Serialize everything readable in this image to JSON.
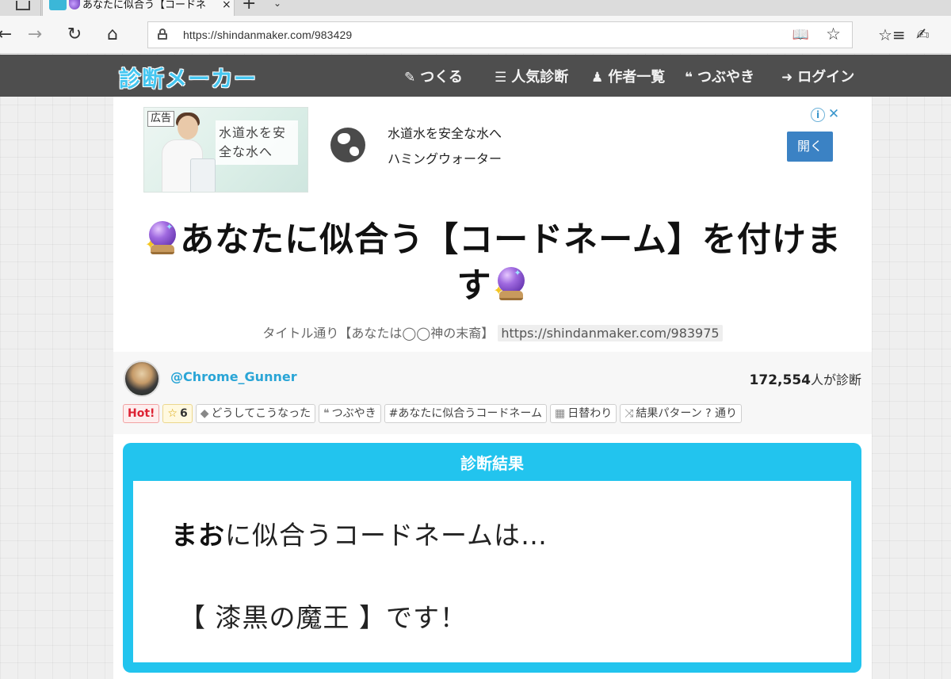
{
  "browser": {
    "tab_title": "あなたに似合う【コードネ",
    "tab_close": "×",
    "new_tab": "+",
    "tab_list": "⌄",
    "url": "https://shindanmaker.com/983429",
    "icons": [
      "back-icon",
      "forward-icon",
      "refresh-icon",
      "home-icon",
      "lock-icon",
      "reading-view-icon",
      "favorite-star-icon",
      "favorites-list-icon",
      "pen-icon"
    ]
  },
  "header": {
    "logo": "診断メーカー",
    "nav": [
      {
        "icon": "edit-icon",
        "glyph": "✎",
        "label": "つくる"
      },
      {
        "icon": "list-icon",
        "glyph": "☰",
        "label": "人気診断"
      },
      {
        "icon": "user-icon",
        "glyph": "👤",
        "label": "作者一覧"
      },
      {
        "icon": "comments-icon",
        "glyph": "💬",
        "label": "つぶやき"
      },
      {
        "icon": "sign-in-icon",
        "glyph": "➜",
        "label": "ログイン"
      }
    ],
    "colors": {
      "background": "#4e4e4e",
      "logo": "#45c6f0"
    }
  },
  "ad": {
    "badge": "広告",
    "image_copy": "水道水を安全な水へ",
    "headline": "水道水を安全な水へ",
    "advertiser": "ハミングウォーター",
    "open_button": "開く",
    "info": "i",
    "close": "✕"
  },
  "page": {
    "title": "あなたに似合う【コードネーム】を付けます",
    "subtitle_text": "タイトル通り【あなたは◯◯神の末裔】",
    "subtitle_link": "https://shindanmaker.com/983975",
    "author": "@Chrome_Gunner",
    "play_count": "172,554",
    "play_count_suffix": "人が診断",
    "tags": [
      {
        "name": "tag-hot",
        "icon": "",
        "label": "Hot!"
      },
      {
        "name": "tag-favorites",
        "icon": "☆",
        "label": "6"
      },
      {
        "name": "tag-category",
        "icon": "🏷",
        "label": "どうしてこうなった"
      },
      {
        "name": "tag-tweets",
        "icon": "💬",
        "label": "つぶやき"
      },
      {
        "name": "tag-hashtag",
        "icon": "",
        "label": "#あなたに似合うコードネーム"
      },
      {
        "name": "tag-daily",
        "icon": "📅",
        "label": "日替わり"
      },
      {
        "name": "tag-patterns",
        "icon": "⤨",
        "label": "結果パターン ? 通り"
      }
    ]
  },
  "result": {
    "heading": "診断結果",
    "user_name": "まお",
    "line1_rest": "に似合うコードネームは…",
    "line2": "【 漆黒の魔王 】です！",
    "accent_color": "#22c4ee"
  }
}
